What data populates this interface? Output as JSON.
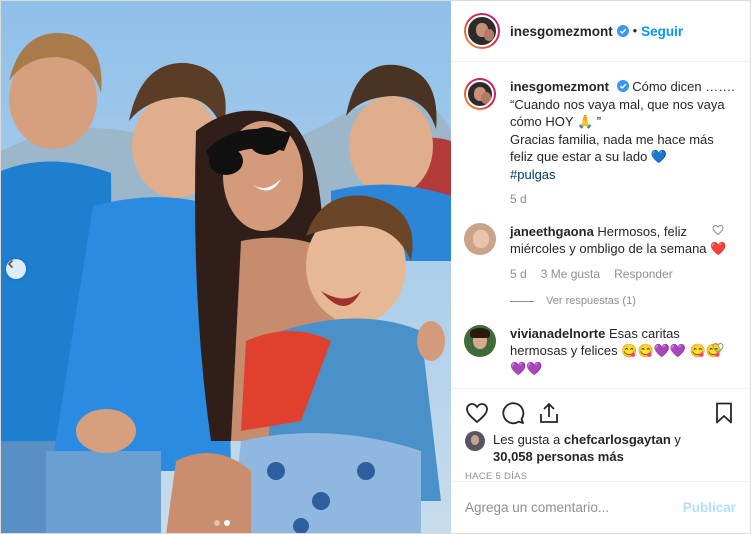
{
  "post": {
    "author": "inesgomezmont",
    "follow_label": "Seguir",
    "separator": "•",
    "carousel": {
      "current": 2,
      "total": 2
    }
  },
  "caption": {
    "username": "inesgomezmont",
    "text": "Cómo dicen ……. “Cuando nos vaya mal, que nos vaya cómo HOY 🙏 ”\nGracias familia, nada me hace más feliz que estar a su lado 💙",
    "hashtag": "#pulgas",
    "time": "5 d"
  },
  "comments": [
    {
      "username": "janeethgaona",
      "text": "Hermosos, feliz miércoles y ombligo de la semana ❤️",
      "time": "5 d",
      "likes": "3 Me gusta",
      "reply_label": "Responder",
      "view_replies": "Ver respuestas (1)"
    },
    {
      "username": "vivianadelnorte",
      "text": "Esas caritas hermosas y felices",
      "emoji_row_1": [
        "😋",
        "😋",
        "💜",
        "💜"
      ],
      "emoji_row_2": [
        "😋",
        "😋",
        "💜",
        "💜"
      ]
    }
  ],
  "likes": {
    "prefix": "Les gusta a ",
    "user": "chefcarlosgaytan",
    "connector": " y",
    "others": "30,058 personas más"
  },
  "timestamp": "HACE 5 DÍAS",
  "add_comment": {
    "placeholder": "Agrega un comentario...",
    "publish_label": "Publicar"
  },
  "colors": {
    "accent": "#0095f6",
    "verified": "#3897f0",
    "publish_disabled": "#b2dffc",
    "muted": "#8e8e8e"
  },
  "icons": {
    "like": "heart-icon",
    "comment": "comment-bubble-icon",
    "share": "share-icon",
    "save": "bookmark-icon",
    "carousel_prev": "chevron-left-icon"
  }
}
